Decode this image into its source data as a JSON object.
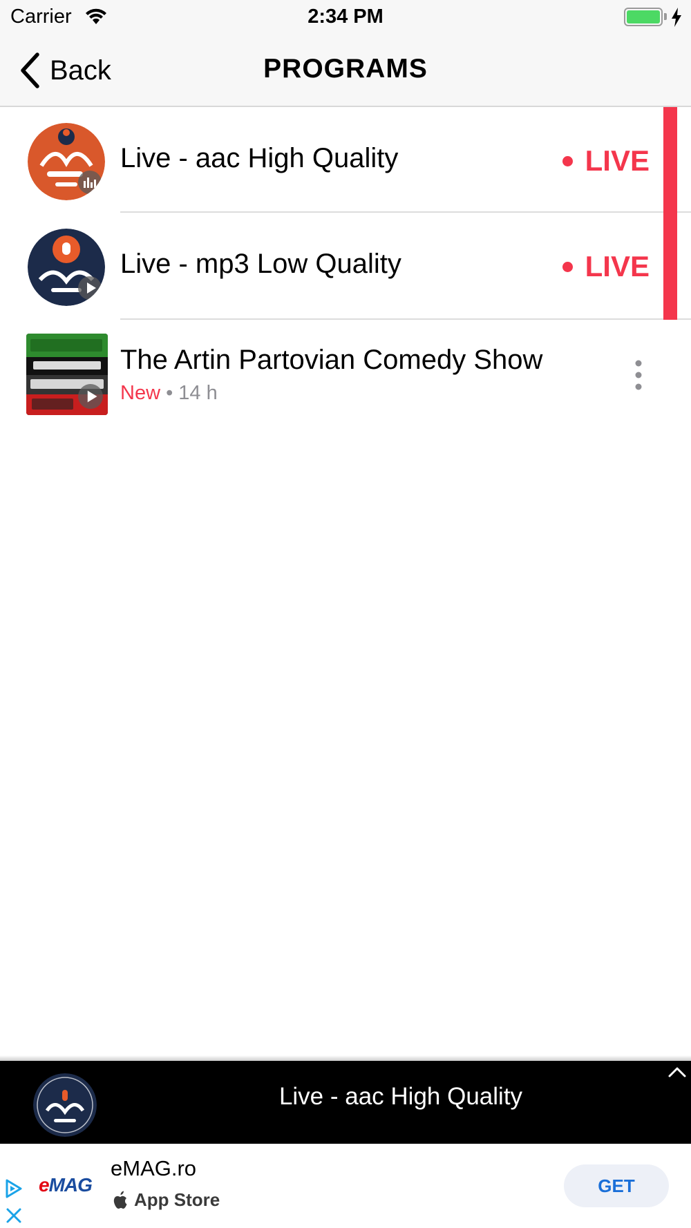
{
  "status_bar": {
    "carrier": "Carrier",
    "time": "2:34 PM",
    "battery_level": 1.0
  },
  "nav": {
    "back_label": "Back",
    "title": "PROGRAMS"
  },
  "programs": [
    {
      "title": "Live - aac High Quality",
      "badge": "LIVE",
      "icon": "radio-logo-orange",
      "playing": true
    },
    {
      "title": "Live - mp3 Low Quality",
      "badge": "LIVE",
      "icon": "radio-logo-navy",
      "playing": false
    },
    {
      "title": "The Artin Partovian Comedy Show",
      "status": "New",
      "age": "14 h",
      "icon": "comedy-show-cover"
    }
  ],
  "player": {
    "now_playing": "Live - aac High Quality"
  },
  "ad": {
    "brand": "eMAG",
    "app_name": "eMAG.ro",
    "store": "App Store",
    "cta": "GET"
  },
  "colors": {
    "accent_red": "#f4364c",
    "ad_blue": "#1a6fd8",
    "battery_green": "#4cd964"
  }
}
